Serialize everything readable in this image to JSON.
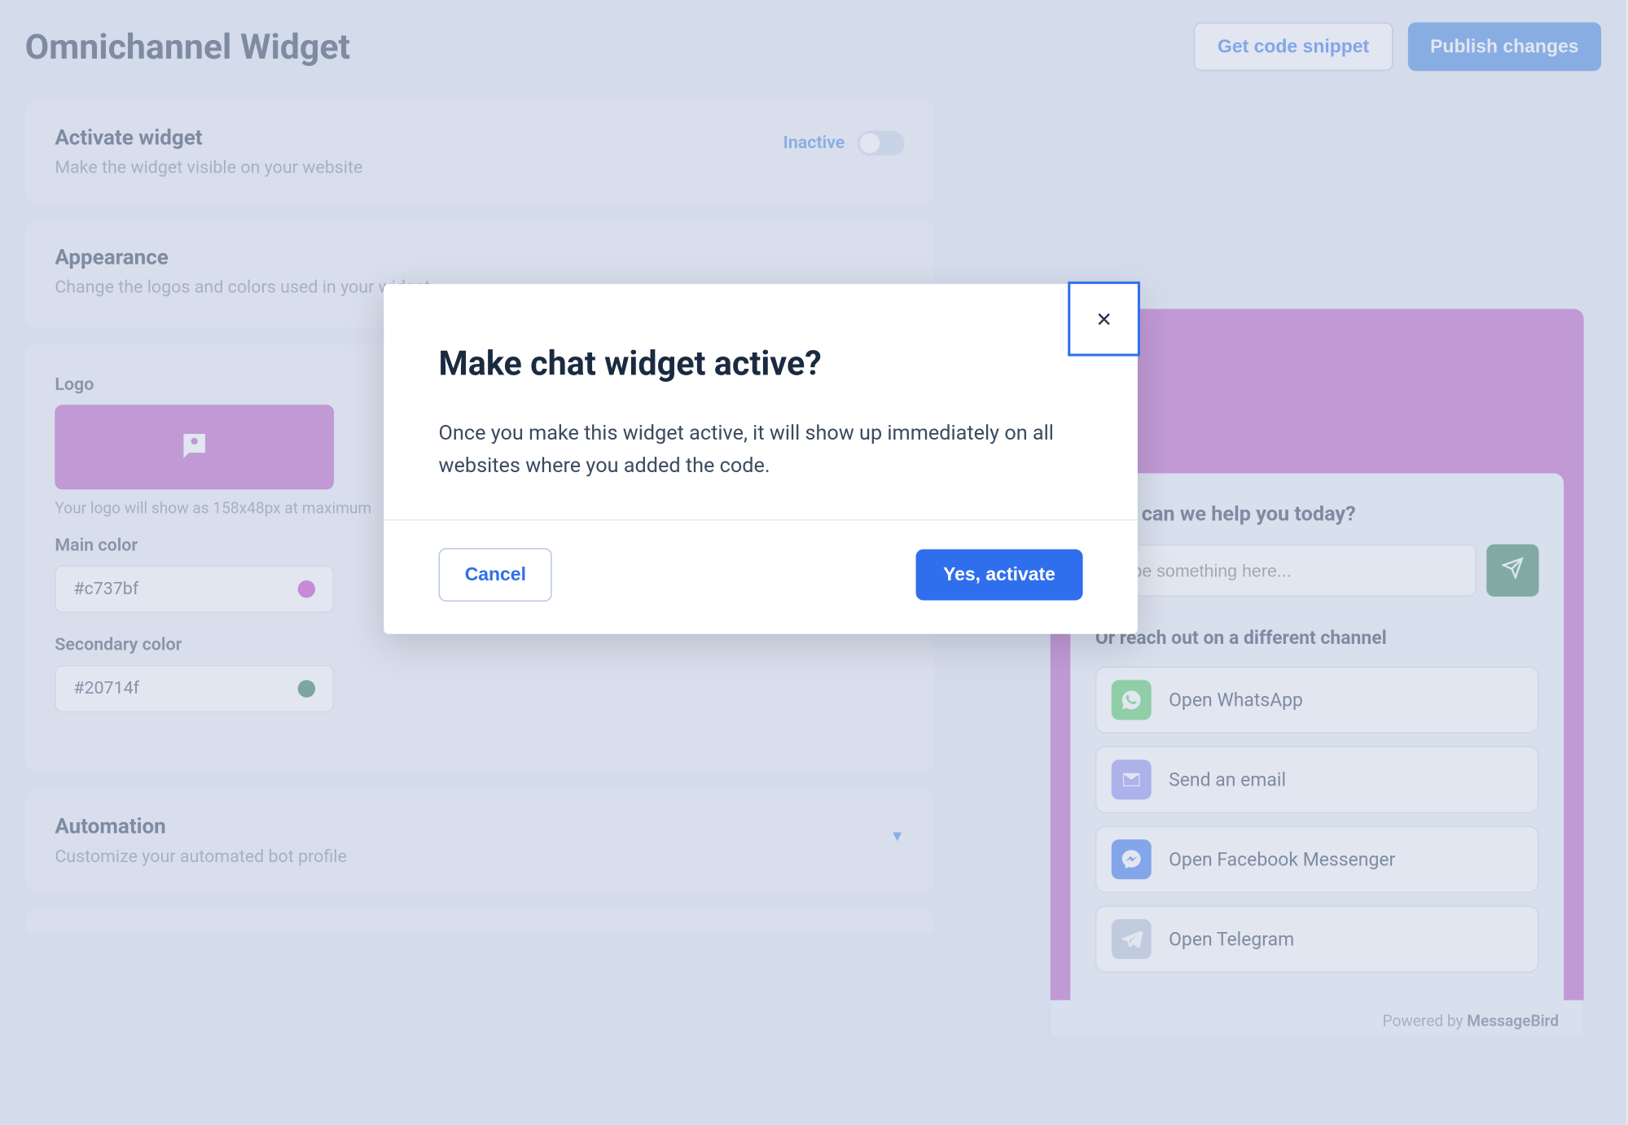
{
  "header": {
    "title": "Omnichannel Widget",
    "get_code_label": "Get code snippet",
    "publish_label": "Publish changes"
  },
  "activate": {
    "title": "Activate widget",
    "subtitle": "Make the widget visible on your website",
    "status_label": "Inactive"
  },
  "appearance": {
    "title": "Appearance",
    "subtitle": "Change the logos and colors used in your widget"
  },
  "logo": {
    "label": "Logo",
    "hint": "Your logo will show as 158x48px at maximum"
  },
  "main_color": {
    "label": "Main color",
    "value": "#c737bf",
    "swatch": "#c737bf"
  },
  "secondary_color": {
    "label": "Secondary color",
    "value": "#20714f",
    "swatch": "#20714f"
  },
  "automation": {
    "title": "Automation",
    "subtitle": "Customize your automated bot profile"
  },
  "preview": {
    "heading": "How can we help you today?",
    "input_placeholder": "Type something here...",
    "or_label": "Or reach out on a different channel",
    "channels": [
      {
        "label": "Open WhatsApp",
        "bg": "#4dc95b",
        "icon": "whatsapp"
      },
      {
        "label": "Send an email",
        "bg": "#8f8cf2",
        "icon": "email"
      },
      {
        "label": "Open Facebook Messenger",
        "bg": "#2f6fed",
        "icon": "messenger"
      },
      {
        "label": "Open Telegram",
        "bg": "#b9c3d6",
        "icon": "telegram"
      }
    ],
    "powered_prefix": "Powered by ",
    "powered_brand": "MessageBird"
  },
  "modal": {
    "title": "Make chat widget active?",
    "body": "Once you make this widget active, it will show up immediately on all websites where you added the code.",
    "cancel": "Cancel",
    "confirm": "Yes, activate"
  }
}
